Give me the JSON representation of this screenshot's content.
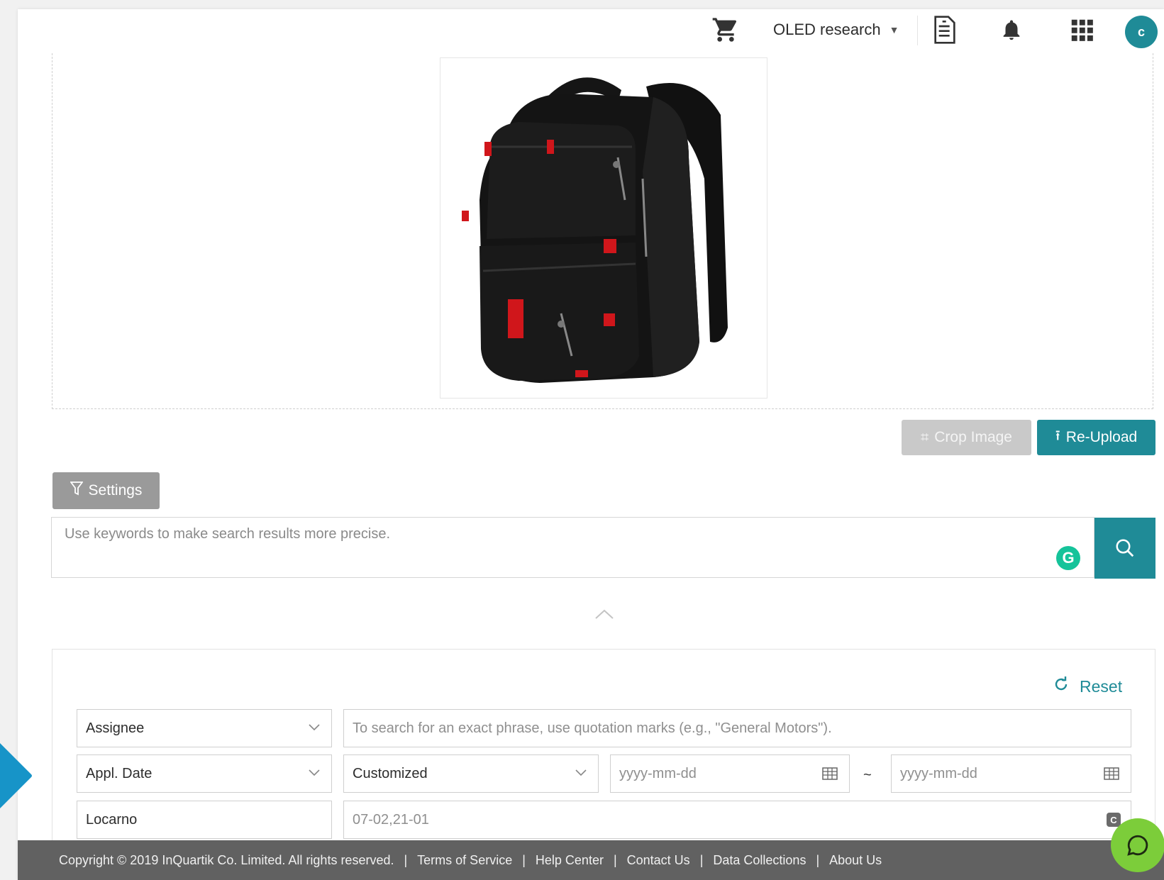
{
  "header": {
    "project_name": "OLED research",
    "project_caret": "▼",
    "avatar_initial": "c",
    "icons": [
      "cart-icon",
      "document-icon",
      "bell-icon",
      "apps-grid-icon"
    ]
  },
  "image_panel": {
    "preview_alt": "Uploaded backpack image",
    "crop_label": "Crop Image",
    "reupload_label": "Re-Upload"
  },
  "settings": {
    "label": "Settings"
  },
  "search": {
    "placeholder": "Use keywords to make search results more precise.",
    "value": "",
    "grammarly_letter": "G"
  },
  "filters": {
    "reset_label": "Reset",
    "rows": [
      {
        "field": "Assignee",
        "input_placeholder": "To search for an exact phrase, use quotation marks (e.g., \"General Motors\")."
      },
      {
        "field": "Appl. Date",
        "range_type": "Customized",
        "from_placeholder": "yyyy-mm-dd",
        "separator": "~",
        "to_placeholder": "yyyy-mm-dd"
      },
      {
        "field": "Locarno",
        "value": "07-02,21-01"
      }
    ]
  },
  "footer": {
    "copyright": "Copyright © 2019 InQuartik Co. Limited. All rights reserved.",
    "links": [
      "Terms of Service",
      "Help Center",
      "Contact Us",
      "Data Collections",
      "About Us"
    ]
  },
  "colors": {
    "accent": "#1f8b97",
    "footer_bg": "#616161",
    "chat_bg": "#7ccd3a",
    "arrow": "#1794c8"
  }
}
